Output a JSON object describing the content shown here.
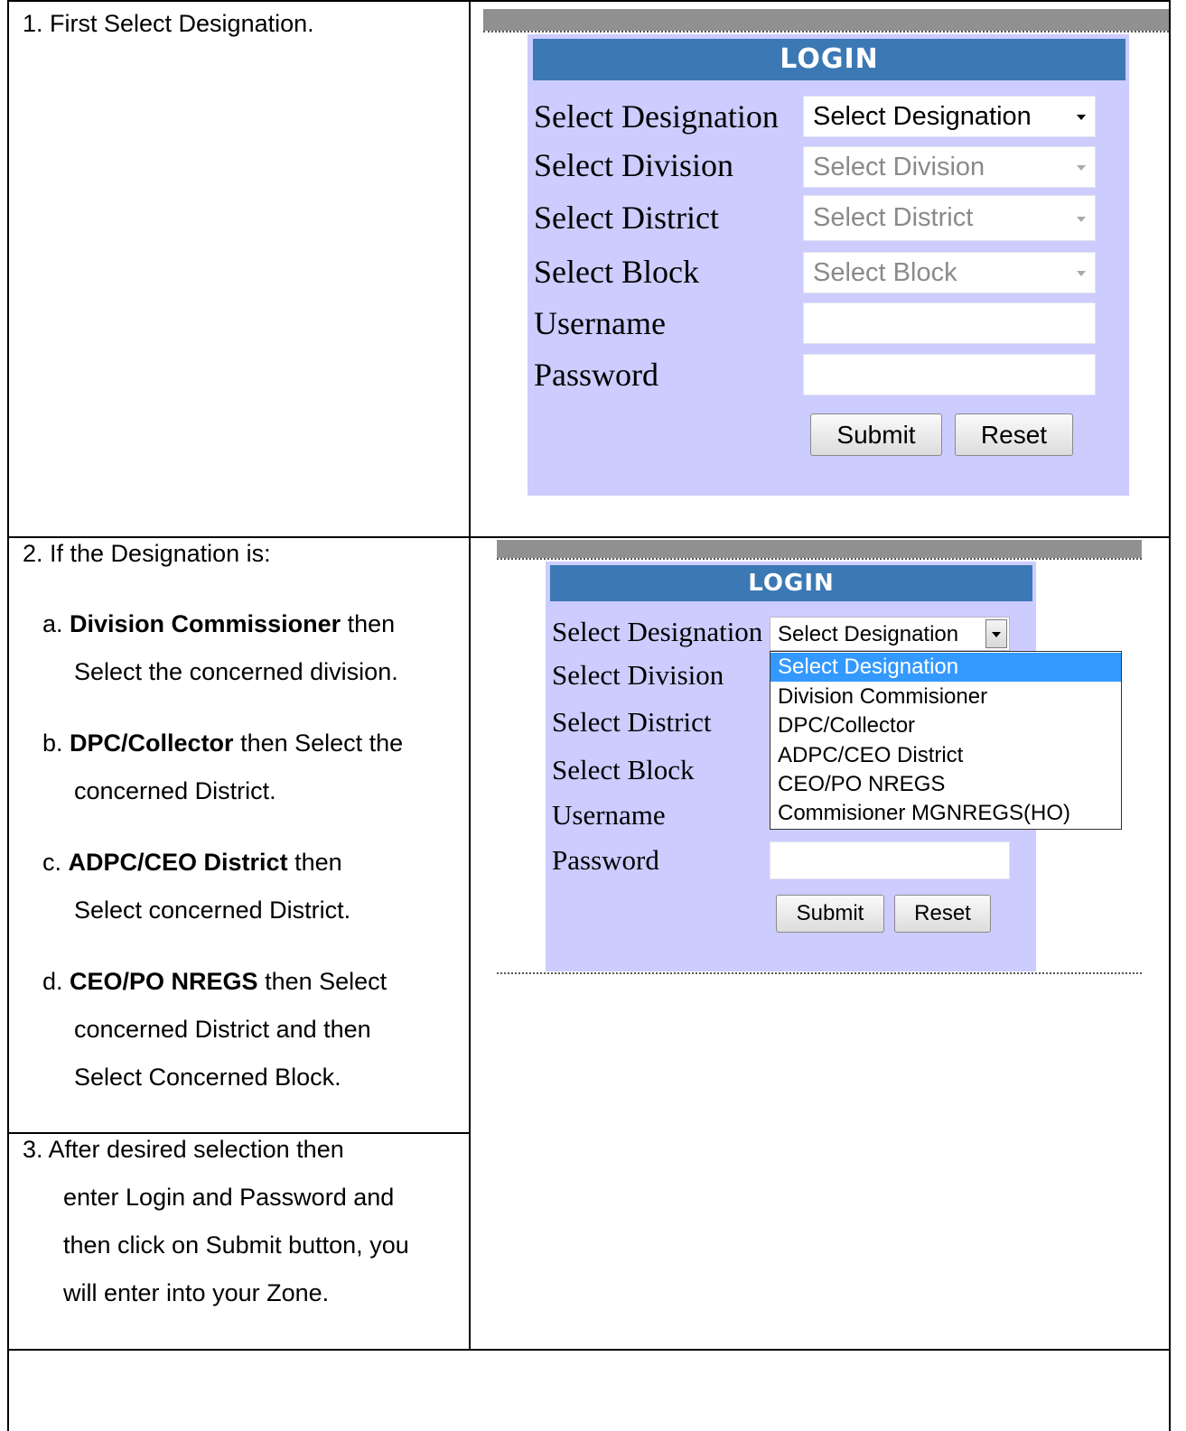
{
  "instructions": {
    "step1": "1.  First Select Designation.",
    "step2_head": "2.  If the Designation is:",
    "step2a_prefix": "a. ",
    "step2a_bold": "Division Commissioner",
    "step2a_rest": " then",
    "step2a_line2": "Select the concerned division.",
    "step2b_prefix": "b. ",
    "step2b_bold": "DPC/Collector",
    "step2b_rest": " then Select the",
    "step2b_line2": "concerned District.",
    "step2c_prefix": "c. ",
    "step2c_bold": "ADPC/CEO District",
    "step2c_rest": " then",
    "step2c_line2": "Select concerned District.",
    "step2d_prefix": "d. ",
    "step2d_bold": "CEO/PO NREGS",
    "step2d_rest": " then Select",
    "step2d_line2": "concerned District and then",
    "step2d_line3": "Select Concerned Block.",
    "step3_line1": "3.  After desired selection then",
    "step3_line2": "enter Login and Password and",
    "step3_line3": "then click on Submit button, you",
    "step3_line4": "will enter into your Zone."
  },
  "login1": {
    "header": "LOGIN",
    "labels": [
      "Select Designation",
      "Select Division",
      "Select District",
      "Select Block",
      "Username",
      "Password"
    ],
    "designation_value": "Select Designation",
    "division_value": "Select Division",
    "district_value": "Select District",
    "block_value": "Select Block",
    "submit": "Submit",
    "reset": "Reset"
  },
  "login2": {
    "header": "LOGIN",
    "labels": [
      "Select Designation",
      "Select Division",
      "Select District",
      "Select Block",
      "Username",
      "Password"
    ],
    "designation_value": "Select Designation",
    "options": [
      "Select Designation",
      "Division Commisioner",
      "DPC/Collector",
      "ADPC/CEO District",
      "CEO/PO NREGS",
      "Commisioner MGNREGS(HO)"
    ],
    "selected_option": "Select Designation",
    "submit": "Submit",
    "reset": "Reset"
  },
  "colors": {
    "login_bg": "#ccccff",
    "header_bg": "#3b78b4",
    "dropdown_highlight": "#3399ff"
  }
}
